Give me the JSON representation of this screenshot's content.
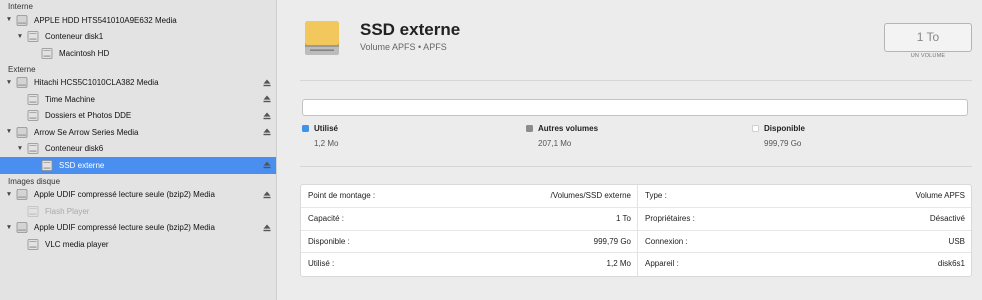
{
  "sidebar": {
    "sections": {
      "internal": "Interne",
      "external": "Externe",
      "images": "Images disque"
    },
    "items": [
      {
        "label": "APPLE HDD HTS541010A9E632 Media"
      },
      {
        "label": "Conteneur disk1"
      },
      {
        "label": "Macintosh HD"
      },
      {
        "label": "Hitachi HCS5C1010CLA382 Media"
      },
      {
        "label": "Time Machine"
      },
      {
        "label": "Dossiers et Photos DDE"
      },
      {
        "label": "Arrow Se Arrow Series Media"
      },
      {
        "label": "Conteneur disk6"
      },
      {
        "label": "SSD externe"
      },
      {
        "label": "Apple UDIF compressé lecture seule (bzip2) Media"
      },
      {
        "label": "Flash Player"
      },
      {
        "label": "Apple UDIF compressé lecture seule (bzip2) Media"
      },
      {
        "label": "VLC media player"
      }
    ]
  },
  "volume": {
    "title": "SSD externe",
    "subtitle": "Volume APFS • APFS",
    "capacity": "1 To",
    "capacity_label": "UN VOLUME"
  },
  "usage": {
    "used_fraction": 1.2e-06,
    "legend": [
      {
        "name": "Utilisé",
        "value": "1,2 Mo",
        "color": "#3e95e8"
      },
      {
        "name": "Autres volumes",
        "value": "207,1 Mo",
        "color": "#8c8c8c"
      },
      {
        "name": "Disponible",
        "value": "999,79 Go",
        "color": "#ffffff"
      }
    ]
  },
  "info": {
    "left": [
      {
        "key": "Point de montage :",
        "value": "/Volumes/SSD externe"
      },
      {
        "key": "Capacité :",
        "value": "1 To"
      },
      {
        "key": "Disponible :",
        "value": "999,79 Go"
      },
      {
        "key": "Utilisé :",
        "value": "1,2 Mo"
      }
    ],
    "right": [
      {
        "key": "Type :",
        "value": "Volume APFS"
      },
      {
        "key": "Propriétaires :",
        "value": "Désactivé"
      },
      {
        "key": "Connexion :",
        "value": "USB"
      },
      {
        "key": "Appareil :",
        "value": "disk6s1"
      }
    ]
  }
}
